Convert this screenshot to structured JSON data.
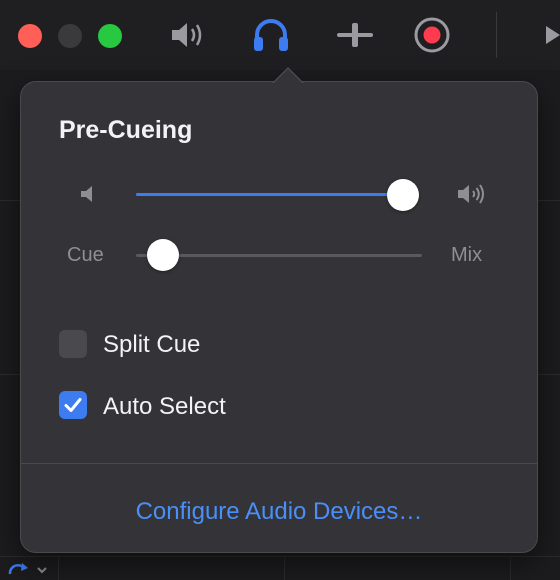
{
  "popover": {
    "title": "Pre-Cueing",
    "volume": {
      "value": 0.96
    },
    "cue_mix": {
      "left_label": "Cue",
      "right_label": "Mix",
      "value": 0.05
    },
    "split_cue": {
      "label": "Split Cue",
      "checked": false
    },
    "auto_select": {
      "label": "Auto Select",
      "checked": true
    },
    "configure_link": "Configure Audio Devices…"
  },
  "icons": {
    "speaker": "speaker-icon",
    "headphones": "headphones-icon",
    "crossfader": "crossfader-icon",
    "record": "record-icon",
    "volume_low": "volume-low-icon",
    "volume_high": "volume-high-icon",
    "checkmark": "checkmark-icon"
  },
  "colors": {
    "accent": "#3d7bf0",
    "record": "#ff3b4f",
    "close": "#ff5f57",
    "maximize": "#28c840"
  }
}
